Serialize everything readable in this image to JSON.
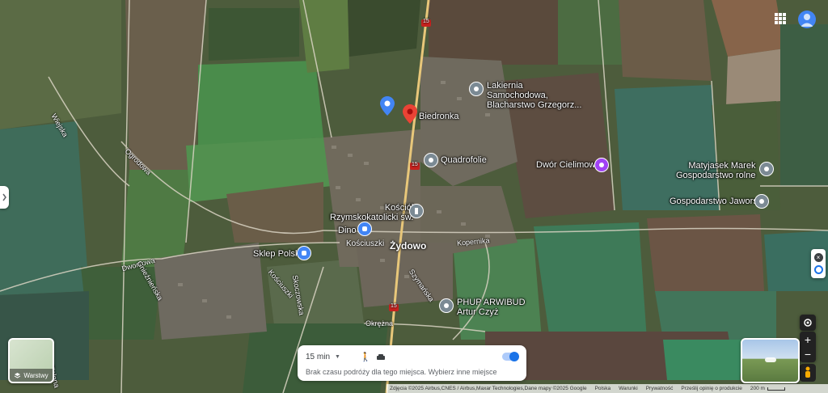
{
  "places": {
    "lakiernia": "Lakiernia Samochodowa, Blacharstwo Grzegorz...",
    "biedronka": "Biedronka",
    "quadrofolie": "Quadrofolie",
    "dwor": "Dwór Cielimowo",
    "matyjasek_line1": "Matyjasek Marek",
    "matyjasek_line2": "Gospodarstwo rolne",
    "jaworski": "Gospodarstwo Jaworski",
    "kosciol_line1": "Kościół",
    "kosciol_line2": "Rzymskokatolicki św.",
    "dino": "Dino",
    "sklep": "Sklep Polski",
    "phup_line1": "PHUP ARWIBUD",
    "phup_line2": "Artur Czyż",
    "town": "Żydowo"
  },
  "roads": {
    "wiejska": "Wiejska",
    "ogrodowa": "Ogrodowa",
    "zielona": "Zielona",
    "dworcowa": "Dworcowa",
    "kosciuszki1": "Kościuszki",
    "kosciuszki2": "Kościuszki",
    "kopernika": "Kopernika",
    "szymanska": "Szymańska",
    "okrezna": "Okrężna",
    "gnieznienska": "Gnieźnieńska",
    "skoczowska": "Skoczowska",
    "route": "15"
  },
  "layers": {
    "label": "Warstwy"
  },
  "travel": {
    "time": "15 min",
    "message": "Brak czasu podróży dla tego miejsca. Wybierz inne miejsce"
  },
  "footer": {
    "attribution": "Zdjęcia ©2025 Airbus,CNES / Airbus,Maxar Technologies,Dane mapy ©2025 Google",
    "country": "Polska",
    "terms": "Warunki",
    "privacy": "Prywatność",
    "feedback": "Prześlij opinię o produkcie",
    "scale": "200 m"
  },
  "colors": {
    "pin_red": "#ea4335",
    "pin_blue": "#4285f4",
    "pin_purple": "#a142f4",
    "poi_gray": "#7b8a94",
    "route_shield": "#c5221f"
  }
}
